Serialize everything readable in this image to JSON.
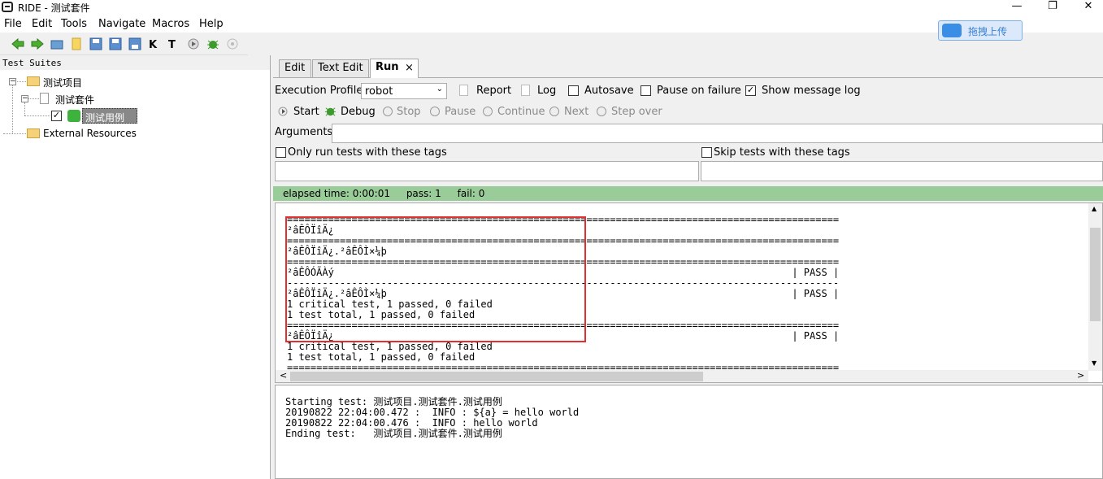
{
  "window": {
    "title": "RIDE - 测试套件",
    "minimize": "—",
    "restore": "❐",
    "close": "✕"
  },
  "menu": [
    "File",
    "Edit",
    "Tools",
    "Navigate",
    "Macros",
    "Help"
  ],
  "baidu_upload": {
    "label": "拖拽上传"
  },
  "left_panel": {
    "header": "Test Suites",
    "tree": {
      "project": "测试项目",
      "suite": "测试套件",
      "testcase": "测试用例",
      "external": "External Resources"
    }
  },
  "tabs": {
    "edit": "Edit",
    "text_edit": "Text Edit",
    "run": "Run",
    "run_close": "×"
  },
  "run": {
    "profile_label": "Execution Profile:",
    "profile_value": "robot",
    "report": "Report",
    "log": "Log",
    "autosave": "Autosave",
    "pause_on_failure": "Pause on failure",
    "show_message_log": "Show message log",
    "show_message_log_checked": true,
    "start": "Start",
    "debug": "Debug",
    "stop": "Stop",
    "pause": "Pause",
    "continue": "Continue",
    "next": "Next",
    "step_over": "Step over",
    "arguments_label": "Arguments:",
    "only_run_tags": "Only run tests with these tags",
    "skip_tags": "Skip tests with these tags"
  },
  "status": {
    "elapsed": "elapsed time: 0:00:01",
    "pass": "pass: 1",
    "fail": "fail: 0"
  },
  "console_lines": [
    "==============================================================================================",
    "²âÊÔÏîÄ¿",
    "==============================================================================================",
    "²âÊÔÏîÄ¿.²âÊÔÌ×¼þ",
    "==============================================================================================",
    "²âÊÔÓÃÀý                                                                              | PASS |",
    "----------------------------------------------------------------------------------------------",
    "²âÊÔÏîÄ¿.²âÊÔÌ×¼þ                                                                     | PASS |",
    "1 critical test, 1 passed, 0 failed",
    "1 test total, 1 passed, 0 failed",
    "==============================================================================================",
    "²âÊÔÏîÄ¿                                                                              | PASS |",
    "1 critical test, 1 passed, 0 failed",
    "1 test total, 1 passed, 0 failed",
    "=============================================================================================="
  ],
  "message_log_lines": [
    "Starting test: 测试项目.测试套件.测试用例",
    "20190822 22:04:00.472 :  INFO : ${a} = hello world",
    "20190822 22:04:00.476 :  INFO : hello world",
    "Ending test:   测试项目.测试套件.测试用例"
  ],
  "scroll_arrows": {
    "up": "▲",
    "down": "▼",
    "left": "<",
    "right": ">"
  }
}
